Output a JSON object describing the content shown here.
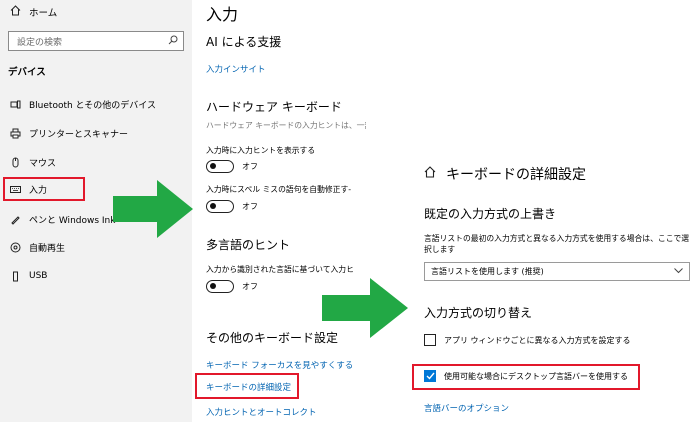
{
  "sidebar": {
    "home_label": "ホーム",
    "search_placeholder": "設定の検索",
    "section_title": "デバイス",
    "items": [
      {
        "label": "Bluetooth とその他のデバイス",
        "icon": "bluetooth-icon"
      },
      {
        "label": "プリンターとスキャナー",
        "icon": "printer-icon"
      },
      {
        "label": "マウス",
        "icon": "mouse-icon"
      },
      {
        "label": "入力",
        "icon": "keyboard-icon"
      },
      {
        "label": "ペンと Windows Ink",
        "icon": "pen-icon"
      },
      {
        "label": "自動再生",
        "icon": "autoplay-icon"
      },
      {
        "label": "USB",
        "icon": "usb-icon"
      }
    ]
  },
  "middle": {
    "page_title": "入力",
    "ai_section": "AI による支援",
    "ai_link": "入力インサイト",
    "hw_keyboard": "ハードウェア キーボード",
    "hw_desc": "ハードウェア キーボードの入力ヒントは、一部",
    "hints_label": "入力時に入力ヒントを表示する",
    "hints_state": "オフ",
    "autocorrect_label": "入力時にスペル ミスの語句を自動修正す-",
    "autocorrect_state": "オフ",
    "multilang_title": "多言語のヒント",
    "multilang_desc": "入力から識別された言語に基づいて入力ヒ",
    "multilang_state": "オフ",
    "other_title": "その他のキーボード設定",
    "link_focus": "キーボード フォーカスを見やすくする",
    "link_advanced": "キーボードの詳細設定",
    "link_hints": "入力ヒントとオートコレクト"
  },
  "right": {
    "title": "キーボードの詳細設定",
    "override_title": "既定の入力方式の上書き",
    "override_desc": "言語リストの最初の入力方式と異なる入力方式を使用する場合は、ここで選択します",
    "dropdown_value": "言語リストを使用します (推奨)",
    "switch_title": "入力方式の切り替え",
    "cb1_label": "アプリ ウィンドウごとに異なる入力方式を設定する",
    "cb1_checked": false,
    "cb2_label": "使用可能な場合にデスクトップ言語バーを使用する",
    "cb2_checked": true,
    "langbar_link": "言語バーのオプション"
  },
  "colors": {
    "accent": "#0078d7",
    "link": "#0063b1",
    "highlight": "#e2182b",
    "arrow": "#22a845",
    "sidebar_bg": "#f2f2f2"
  }
}
